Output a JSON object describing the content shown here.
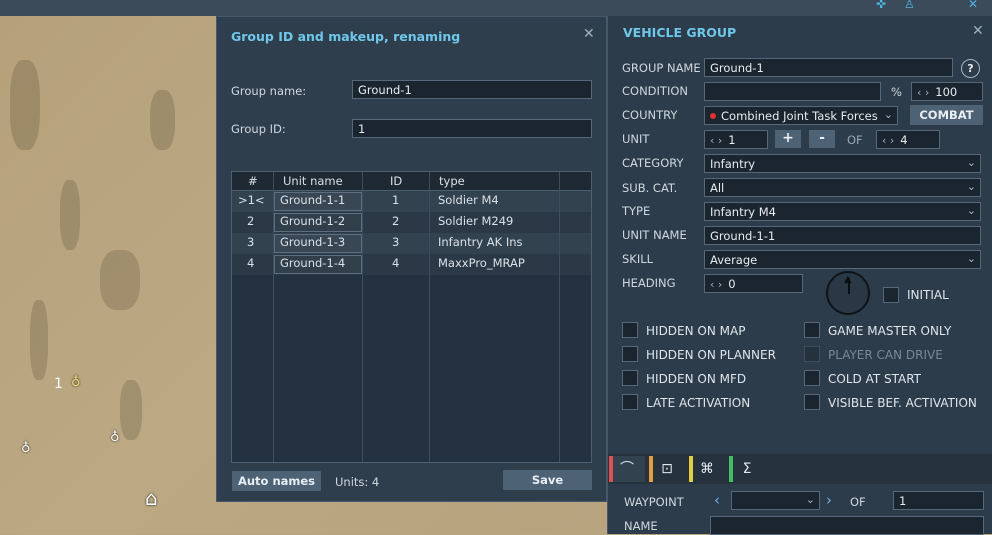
{
  "map": {
    "unit_number": "1"
  },
  "group_dialog": {
    "title": "Group ID and makeup, renaming",
    "group_name_label": "Group name:",
    "group_name_value": "Ground-1",
    "group_id_label": "Group ID:",
    "group_id_value": "1",
    "table": {
      "headers": [
        "#",
        "Unit name",
        "ID",
        "type"
      ],
      "rows": [
        {
          "num": ">1<",
          "name": "Ground-1-1",
          "id": "1",
          "type": "Soldier M4"
        },
        {
          "num": "2",
          "name": "Ground-1-2",
          "id": "2",
          "type": "Soldier M249"
        },
        {
          "num": "3",
          "name": "Ground-1-3",
          "id": "3",
          "type": "Infantry AK Ins"
        },
        {
          "num": "4",
          "name": "Ground-1-4",
          "id": "4",
          "type": "MaxxPro_MRAP"
        }
      ]
    },
    "auto_names_label": "Auto names",
    "units_count": "Units: 4",
    "save_label": "Save"
  },
  "vehicle_group": {
    "title": "VEHICLE GROUP",
    "help_label": "?",
    "group_name_label": "GROUP NAME",
    "group_name_value": "Ground-1",
    "condition_label": "CONDITION",
    "condition_value": "",
    "condition_percent_sign": "%",
    "condition_percent_value": "100",
    "country_label": "COUNTRY",
    "country_value": "Combined Joint Task Forces",
    "country_dot_color": "#e03030",
    "combat_label": "COMBAT",
    "unit_label": "UNIT",
    "unit_value": "1",
    "plus_label": "+",
    "minus_label": "-",
    "of_label": "OF",
    "unit_total": "4",
    "category_label": "CATEGORY",
    "category_value": "Infantry",
    "subcat_label": "SUB. CAT.",
    "subcat_value": "All",
    "type_label": "TYPE",
    "type_value": "Infantry M4",
    "unit_name_label": "UNIT NAME",
    "unit_name_value": "Ground-1-1",
    "skill_label": "SKILL",
    "skill_value": "Average",
    "heading_label": "HEADING",
    "heading_value": "0",
    "initial_label": "INITIAL",
    "checkboxes_left": [
      "HIDDEN ON MAP",
      "HIDDEN ON PLANNER",
      "HIDDEN ON MFD",
      "LATE ACTIVATION"
    ],
    "checkboxes_right": [
      "GAME MASTER ONLY",
      "PLAYER CAN DRIVE",
      "COLD AT START",
      "VISIBLE BEF. ACTIVATION"
    ],
    "tabs": [
      {
        "icon": "route-icon",
        "color": "#e05050"
      },
      {
        "icon": "target-icon",
        "color": "#e0a040"
      },
      {
        "icon": "triggers-icon",
        "color": "#e0d040"
      },
      {
        "icon": "summary-icon",
        "color": "#40c060"
      }
    ],
    "waypoint_label": "WAYPOINT",
    "waypoint_of_label": "OF",
    "waypoint_total": "1",
    "name_label": "NAME"
  }
}
